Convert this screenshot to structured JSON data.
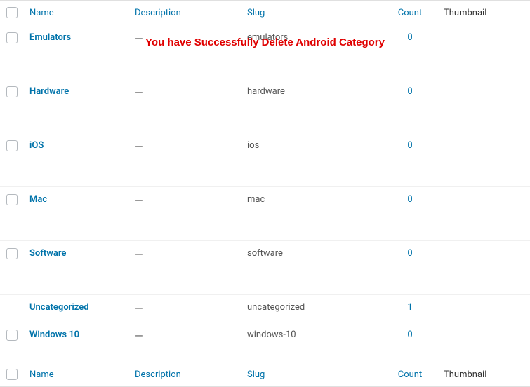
{
  "columns": {
    "name": "Name",
    "description": "Description",
    "slug": "Slug",
    "count": "Count",
    "thumbnail": "Thumbnail"
  },
  "banner": "You have Successfully Delete Android Category",
  "rows": [
    {
      "name": "Emulators",
      "description": "—",
      "slug": "emulators",
      "count": "0",
      "has_checkbox": true,
      "row_class": "tall"
    },
    {
      "name": "Hardware",
      "description": "—",
      "slug": "hardware",
      "count": "0",
      "has_checkbox": true,
      "row_class": "tall"
    },
    {
      "name": "iOS",
      "description": "—",
      "slug": "ios",
      "count": "0",
      "has_checkbox": true,
      "row_class": "tall"
    },
    {
      "name": "Mac",
      "description": "—",
      "slug": "mac",
      "count": "0",
      "has_checkbox": true,
      "row_class": "tall"
    },
    {
      "name": "Software",
      "description": "—",
      "slug": "software",
      "count": "0",
      "has_checkbox": true,
      "row_class": "tall"
    },
    {
      "name": "Uncategorized",
      "description": "—",
      "slug": "uncategorized",
      "count": "1",
      "has_checkbox": false,
      "row_class": ""
    },
    {
      "name": "Windows 10",
      "description": "—",
      "slug": "windows-10",
      "count": "0",
      "has_checkbox": true,
      "row_class": "med"
    }
  ]
}
